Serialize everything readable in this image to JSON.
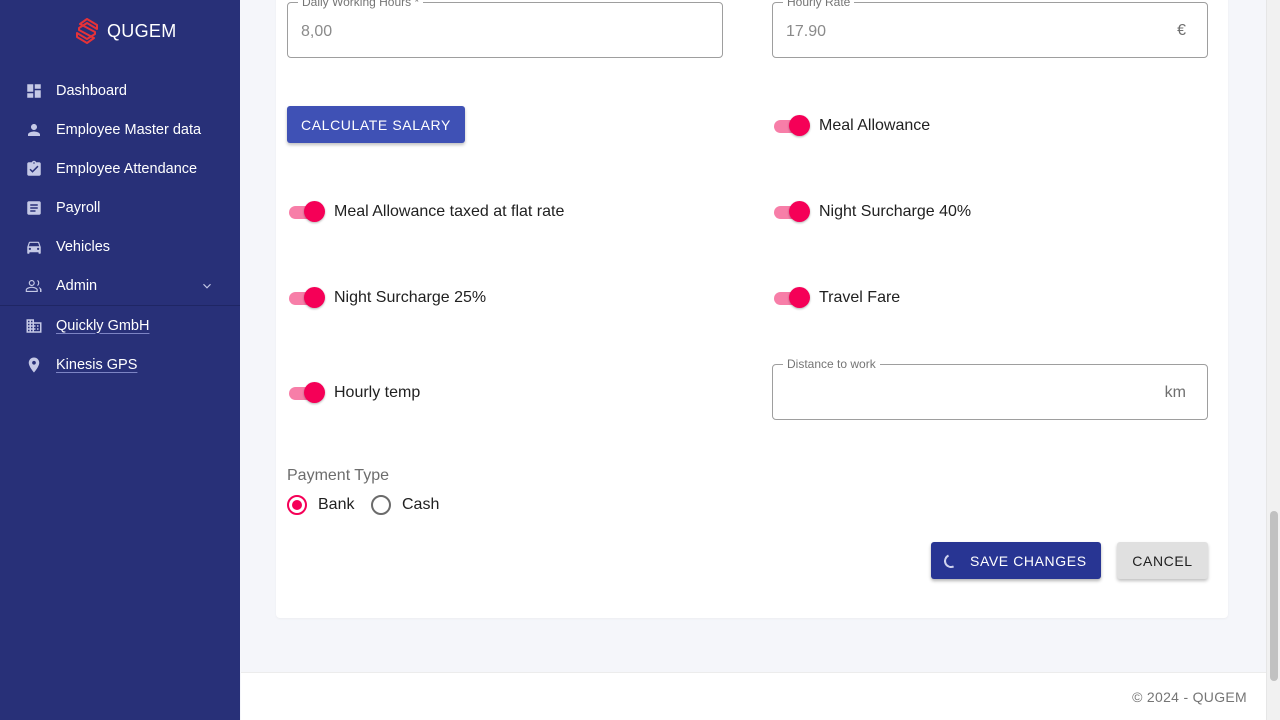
{
  "app": {
    "brand": "QUGEM"
  },
  "sidebar": {
    "items": [
      {
        "label": "Dashboard",
        "icon": "dashboard-icon"
      },
      {
        "label": "Employee Master data",
        "icon": "person-icon"
      },
      {
        "label": "Employee Attendance",
        "icon": "clipboard-check-icon"
      },
      {
        "label": "Payroll",
        "icon": "document-list-icon"
      },
      {
        "label": "Vehicles",
        "icon": "car-icon"
      },
      {
        "label": "Admin",
        "icon": "users-icon"
      },
      {
        "label": "Quickly GmbH",
        "icon": "building-icon"
      },
      {
        "label": "Kinesis GPS",
        "icon": "location-pin-icon"
      }
    ]
  },
  "form": {
    "daily_hours": {
      "label": "Daily Working Hours *",
      "value": "8,00"
    },
    "hourly_rate": {
      "label": "Hourly Rate",
      "value": "17.90",
      "suffix": "€"
    },
    "calculate_label": "CALCULATE SALARY",
    "toggles": {
      "meal_allowance": {
        "label": "Meal Allowance",
        "checked": true
      },
      "meal_flat": {
        "label": "Meal Allowance taxed at flat rate",
        "checked": true
      },
      "night_40": {
        "label": "Night Surcharge 40%",
        "checked": true
      },
      "night_25": {
        "label": "Night Surcharge 25%",
        "checked": true
      },
      "travel_fare": {
        "label": "Travel Fare",
        "checked": true
      },
      "hourly_temp": {
        "label": "Hourly temp",
        "checked": true
      }
    },
    "distance": {
      "label": "Distance to work",
      "value": "",
      "suffix": "km"
    },
    "payment_type": {
      "label": "Payment Type",
      "options": [
        "Bank",
        "Cash"
      ],
      "selected": "Bank"
    },
    "save_label": "SAVE CHANGES",
    "cancel_label": "CANCEL"
  },
  "footer": {
    "text": "© 2024 - QUGEM"
  },
  "colors": {
    "sidebar": "#283078",
    "primary": "#3f51b5",
    "accent": "#f50057"
  }
}
